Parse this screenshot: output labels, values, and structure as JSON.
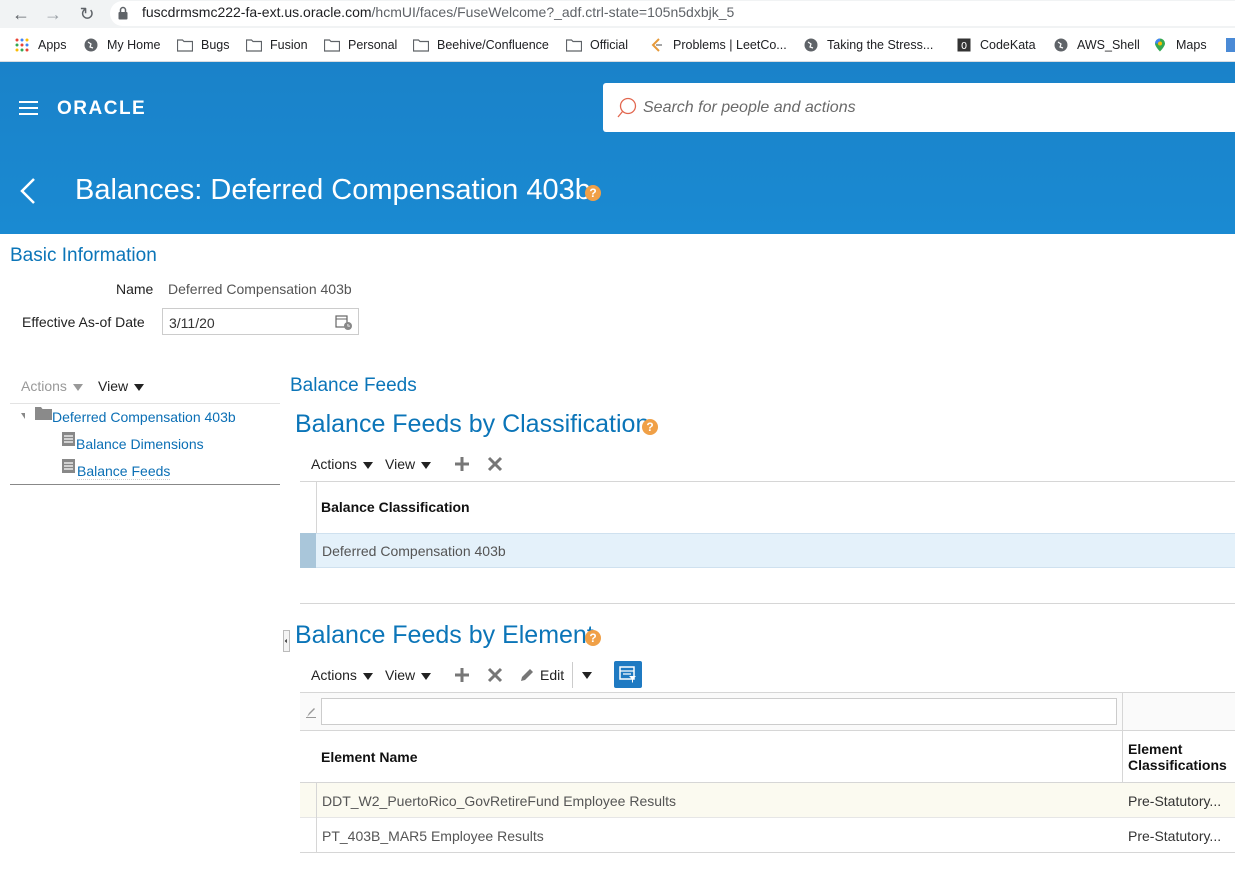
{
  "browser": {
    "url_host": "fuscdrmsmc222-fa-ext.us.oracle.com",
    "url_path": "/hcmUI/faces/FuseWelcome?_adf.ctrl-state=105n5dxbjk_5",
    "bookmarks": [
      "Apps",
      "My Home",
      "Bugs",
      "Fusion",
      "Personal",
      "Beehive/Confluence",
      "Official",
      "Problems | LeetCo...",
      "Taking the Stress...",
      "CodeKata",
      "AWS_Shell",
      "Maps"
    ]
  },
  "header": {
    "logo": "ORACLE",
    "search_placeholder": "Search for people and actions",
    "page_title": "Balances: Deferred Compensation 403b",
    "help_glyph": "?"
  },
  "basic_info": {
    "heading": "Basic Information",
    "name_label": "Name",
    "name_value": "Deferred Compensation 403b",
    "date_label": "Effective As-of Date",
    "date_value": "3/11/20"
  },
  "tree": {
    "actions_label": "Actions",
    "view_label": "View",
    "root": "Deferred Compensation 403b",
    "children": [
      "Balance Dimensions",
      "Balance Feeds"
    ]
  },
  "balance_feeds": {
    "heading": "Balance Feeds",
    "by_classification": {
      "heading": "Balance Feeds by Classification",
      "actions_label": "Actions",
      "view_label": "View",
      "column": "Balance Classification",
      "rows": [
        "Deferred Compensation 403b"
      ]
    },
    "by_element": {
      "heading": "Balance Feeds by Element",
      "actions_label": "Actions",
      "view_label": "View",
      "edit_label": "Edit",
      "columns": [
        "Element Name",
        "Element",
        "Classifications"
      ],
      "rows": [
        {
          "name": "DDT_W2_PuertoRico_GovRetireFund Employee Results",
          "classification": "Pre-Statutory..."
        },
        {
          "name": "PT_403B_MAR5 Employee Results",
          "classification": "Pre-Statutory..."
        }
      ]
    }
  },
  "colors": {
    "brand_blue": "#1a86ce",
    "link_blue": "#0b75b8",
    "help_orange": "#f0a047",
    "selected_row": "#e4f1fa"
  }
}
